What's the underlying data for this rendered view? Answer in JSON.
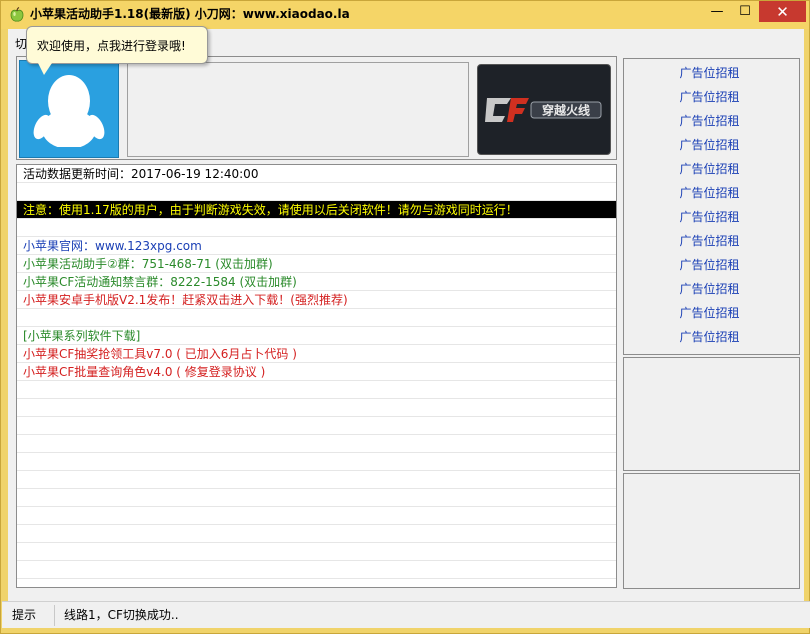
{
  "window": {
    "title": "小苹果活动助手1.18(最新版) 小刀网：www.xiaodao.la",
    "minimize_glyph": "—",
    "maximize_glyph": "☐",
    "close_glyph": "✕",
    "frame_color": "#f0d36a",
    "close_color": "#c7392f"
  },
  "tab": {
    "label": "切"
  },
  "tooltip": {
    "text": "欢迎使用，点我进行登录哦!"
  },
  "header_panel": {
    "avatar_icon": "qq-penguin-icon",
    "game_logo_icon": "crossfire-logo-icon",
    "game_logo_text": "穿越火线",
    "avatar_color": "#2aa0e0"
  },
  "log": {
    "rows": [
      {
        "text": "活动数据更新时间：2017-06-19 12:40:00",
        "color": "#000000"
      },
      {
        "text": "",
        "color": "#000000"
      },
      {
        "text": "注意：使用1.17版的用户，由于判断游戏失效，请使用以后关闭软件！请勿与游戏同时运行！",
        "color": "#ffff00",
        "notice": true
      },
      {
        "text": "",
        "color": "#000000"
      },
      {
        "text": "小苹果官网：www.123xpg.com",
        "color": "#1a3fb5"
      },
      {
        "text": "小苹果活动助手②群：751-468-71 (双击加群)",
        "color": "#2a8a2a"
      },
      {
        "text": "小苹果CF活动通知禁言群：8222-1584 (双击加群)",
        "color": "#2a8a2a"
      },
      {
        "text": "小苹果安卓手机版V2.1发布！赶紧双击进入下载！(强烈推荐)",
        "color": "#d42020"
      },
      {
        "text": "",
        "color": "#000000"
      },
      {
        "text": "[小苹果系列软件下载]",
        "color": "#2a8a2a"
      },
      {
        "text": "小苹果CF抽奖抢领工具v7.0 ( 已加入6月占卜代码 )",
        "color": "#d42020"
      },
      {
        "text": "小苹果CF批量查询角色v4.0 ( 修复登录协议 )",
        "color": "#d42020"
      },
      {
        "text": "",
        "color": "#000000"
      },
      {
        "text": "",
        "color": "#000000"
      },
      {
        "text": "",
        "color": "#000000"
      },
      {
        "text": "",
        "color": "#000000"
      },
      {
        "text": "",
        "color": "#000000"
      },
      {
        "text": "",
        "color": "#000000"
      },
      {
        "text": "",
        "color": "#000000"
      },
      {
        "text": "",
        "color": "#000000"
      },
      {
        "text": "",
        "color": "#000000"
      },
      {
        "text": "",
        "color": "#000000"
      },
      {
        "text": "",
        "color": "#000000"
      },
      {
        "text": "",
        "color": "#000000"
      }
    ]
  },
  "ads": {
    "items": [
      "广告位招租",
      "广告位招租",
      "广告位招租",
      "广告位招租",
      "广告位招租",
      "广告位招租",
      "广告位招租",
      "广告位招租",
      "广告位招租",
      "广告位招租",
      "广告位招租",
      "广告位招租"
    ],
    "link_color": "#1a3fb5"
  },
  "status": {
    "label": "提示",
    "message": "线路1，CF切换成功.."
  }
}
